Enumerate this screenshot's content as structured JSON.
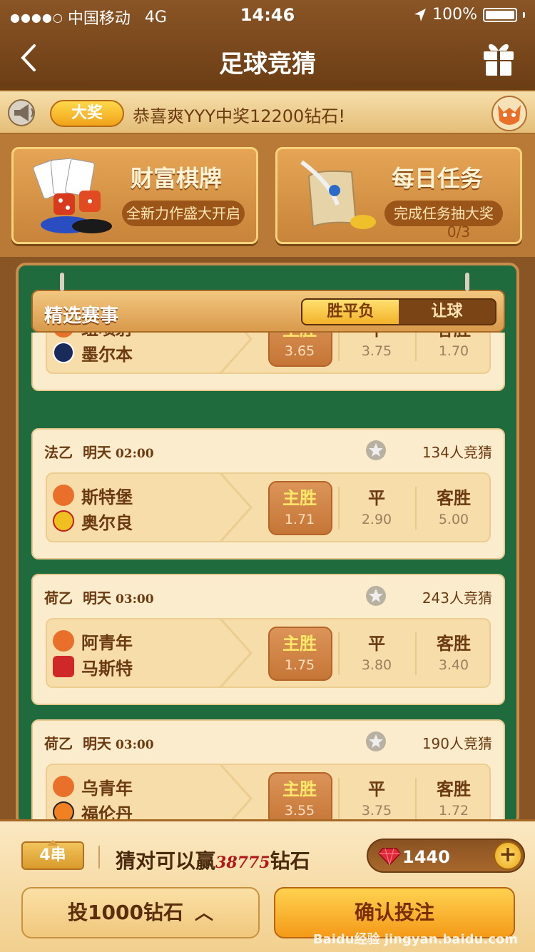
{
  "status": {
    "carrier": "中国移动",
    "network": "4G",
    "time": "14:46",
    "battery": "100%"
  },
  "nav": {
    "title": "足球竞猜"
  },
  "marquee": {
    "badge": "大奖",
    "message": "恭喜爽YYY中奖12200钻石!"
  },
  "cards": [
    {
      "title": "财富棋牌",
      "subtitle": "全新力作盛大开启"
    },
    {
      "title": "每日任务",
      "subtitle": "完成任务抽大奖",
      "progress": "0/3"
    }
  ],
  "section": {
    "title": "精选赛事",
    "tabs": [
      "胜平负",
      "让球"
    ]
  },
  "partial_match": {
    "home": "纽喷射",
    "away": "墨尔本",
    "odds": [
      {
        "label": "主胜",
        "value": "3.65"
      },
      {
        "label": "平",
        "value": "3.75"
      },
      {
        "label": "客胜",
        "value": "1.70"
      }
    ]
  },
  "matches": [
    {
      "league": "法乙",
      "day": "明天",
      "time": "02:00",
      "count": "134人竞猜",
      "home": "斯特堡",
      "away": "奥尔良",
      "odds": [
        {
          "label": "主胜",
          "value": "1.71"
        },
        {
          "label": "平",
          "value": "2.90"
        },
        {
          "label": "客胜",
          "value": "5.00"
        }
      ]
    },
    {
      "league": "荷乙",
      "day": "明天",
      "time": "03:00",
      "count": "243人竞猜",
      "home": "阿青年",
      "away": "马斯特",
      "odds": [
        {
          "label": "主胜",
          "value": "1.75"
        },
        {
          "label": "平",
          "value": "3.80"
        },
        {
          "label": "客胜",
          "value": "3.40"
        }
      ]
    },
    {
      "league": "荷乙",
      "day": "明天",
      "time": "03:00",
      "count": "190人竞猜",
      "home": "乌青年",
      "away": "福伦丹",
      "odds": [
        {
          "label": "主胜",
          "value": "3.55"
        },
        {
          "label": "平",
          "value": "3.75"
        },
        {
          "label": "客胜",
          "value": "1.72"
        }
      ]
    }
  ],
  "footer": {
    "series": "4串",
    "win_prefix": "猜对可以赢",
    "win_amount": "38775",
    "win_suffix": "钻石",
    "balance": "1440",
    "bet_label": "投1000钻石",
    "confirm_label": "确认投注",
    "watermark": "Baidu经验 jingyan.baidu.com"
  },
  "colors": {
    "brown": "#6b3a10",
    "green_felt": "#1f6b3e",
    "selected_odds": "#ffe86a",
    "win_red": "#b01818"
  }
}
